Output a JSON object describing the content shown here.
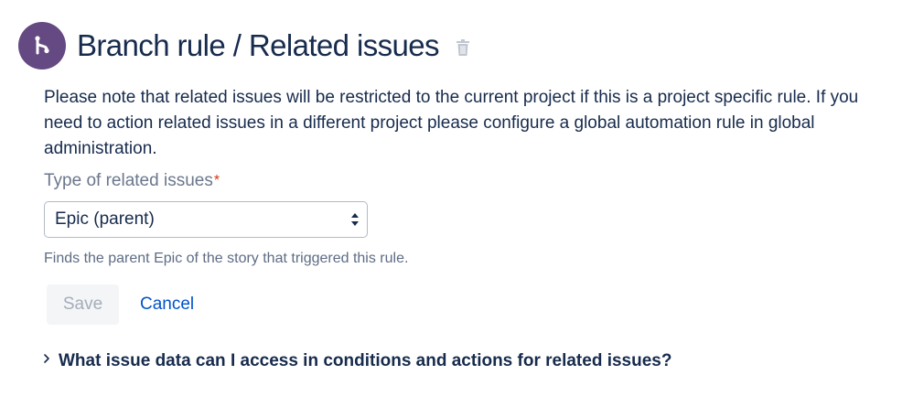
{
  "header": {
    "icon": "branch-icon",
    "title": "Branch rule / Related issues",
    "delete_icon": "trash-icon",
    "badge_color": "#654982"
  },
  "note": "Please note that related issues will be restricted to the current project if this is a project specific rule. If you need to action related issues in a different project please configure a global automation rule in global administration.",
  "form": {
    "type_label": "Type of related issues",
    "required_marker": "*",
    "type_value": "Epic (parent)",
    "helper_text": "Finds the parent Epic of the story that triggered this rule.",
    "save_label": "Save",
    "cancel_label": "Cancel"
  },
  "faq": {
    "icon": "chevron-right-icon",
    "question": "What issue data can I access in conditions and actions for related issues?"
  },
  "colors": {
    "link": "#0052cc",
    "text": "#172b4d",
    "required": "#de350b"
  }
}
